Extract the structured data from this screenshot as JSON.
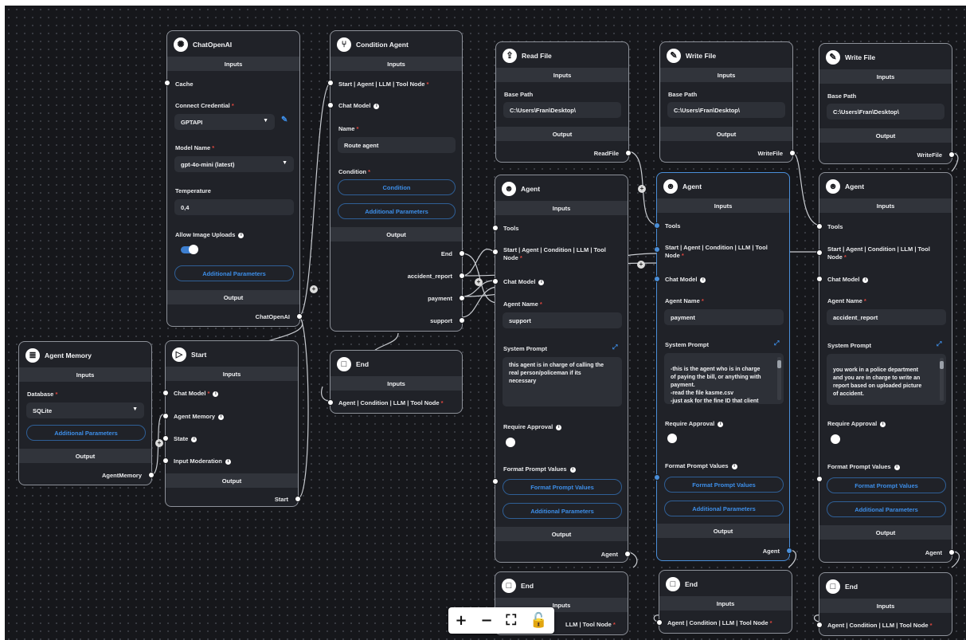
{
  "common": {
    "inputs": "Inputs",
    "output": "Output",
    "additional_parameters": "Additional Parameters"
  },
  "chatopenai": {
    "title": "ChatOpenAI",
    "cache": "Cache",
    "connect_credential": "Connect Credential",
    "credential_value": "GPTAPI",
    "model_name": "Model Name",
    "model_value": "gpt-4o-mini (latest)",
    "temperature": "Temperature",
    "temperature_value": "0,4",
    "allow_image_uploads": "Allow Image Uploads",
    "output_handle": "ChatOpenAI"
  },
  "condition_agent": {
    "title": "Condition Agent",
    "input_start": "Start | Agent | LLM | Tool Node",
    "chat_model": "Chat Model",
    "name_label": "Name",
    "name_value": "Route agent",
    "condition_label": "Condition",
    "condition_button": "Condition",
    "outputs": [
      "End",
      "accident_report",
      "payment",
      "support"
    ]
  },
  "agent_memory": {
    "title": "Agent Memory",
    "database": "Database",
    "database_value": "SQLite",
    "output_handle": "AgentMemory"
  },
  "start": {
    "title": "Start",
    "chat_model": "Chat Model",
    "agent_memory": "Agent Memory",
    "state": "State",
    "input_moderation": "Input Moderation",
    "output_handle": "Start"
  },
  "end_mid": {
    "title": "End",
    "input": "Agent | Condition | LLM | Tool Node"
  },
  "read_file": {
    "title": "Read File",
    "base_path": "Base Path",
    "base_path_value": "C:\\Users\\Fran\\Desktop\\",
    "output_handle": "ReadFile"
  },
  "write_file_1": {
    "title": "Write File",
    "base_path": "Base Path",
    "base_path_value": "C:\\Users\\Fran\\Desktop\\",
    "output_handle": "WriteFile"
  },
  "write_file_2": {
    "title": "Write File",
    "base_path": "Base Path",
    "base_path_value": "C:\\Users\\Fran\\Desktop\\",
    "output_handle": "WriteFile"
  },
  "agent_labels": {
    "title": "Agent",
    "tools": "Tools",
    "start_input": "Start | Agent | Condition | LLM | Tool Node",
    "chat_model": "Chat Model",
    "agent_name": "Agent Name",
    "system_prompt": "System Prompt",
    "require_approval": "Require Approval",
    "format_prompt_values_label": "Format Prompt Values",
    "format_prompt_values_button": "Format Prompt Values",
    "output_handle": "Agent"
  },
  "agent_1": {
    "agent_name_value": "support",
    "system_prompt_value": "this agent is in charge of calling the\nreal person/policeman if its\nnecessary"
  },
  "agent_2": {
    "agent_name_value": "payment",
    "system_prompt_value": "-this is the agent who is in charge\nof paying the bill, or anything with\npayment.\n-read the file kasme.csv\n-just ask for the fine ID that client"
  },
  "agent_3": {
    "agent_name_value": "accident_report",
    "system_prompt_value": "you work in a police department\nand you are in charge to write an\nreport based on uploaded picture\nof accident."
  },
  "end_bottom": {
    "title": "End",
    "input": "Agent | Condition | LLM | Tool Node",
    "input_partial": "LLM | Tool Node"
  },
  "controls": {
    "zoom_in": "+",
    "zoom_out": "−",
    "fit_view": "⛶",
    "lock": "🔓"
  },
  "colors": {
    "canvas": "#16171b",
    "node": "#202228",
    "band": "#31343b",
    "accent": "#3d8ee8",
    "required": "#e0473f"
  }
}
